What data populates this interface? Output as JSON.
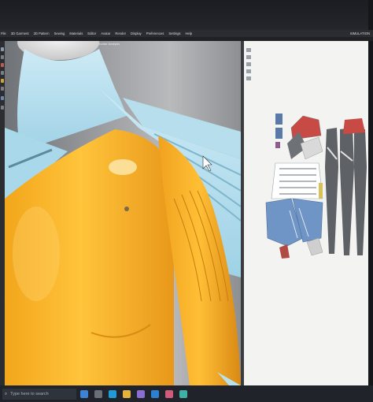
{
  "menu": {
    "items": [
      "File",
      "3D Garment",
      "2D Pattern",
      "Sewing",
      "Materials",
      "Editor",
      "Avatar",
      "Render",
      "Display",
      "Preferences",
      "Settings",
      "Help"
    ],
    "workspace": "SIMULATION"
  },
  "viewport": {
    "title": "Avatar Analysis"
  },
  "taskbar": {
    "search_placeholder": "Type here to search"
  },
  "colors": {
    "garment": "#b8e1ef",
    "avatar": "#f6b62b",
    "panel": "#f3f3f2",
    "pattern_grey": "#5e6266",
    "pattern_blue": "#6d93c4",
    "pattern_red": "#a8413d"
  },
  "icons": [
    "search-icon",
    "windows-icon",
    "task-view-icon",
    "edge-icon",
    "explorer-icon",
    "store-icon",
    "mail-icon",
    "photos-icon",
    "app-icon"
  ]
}
